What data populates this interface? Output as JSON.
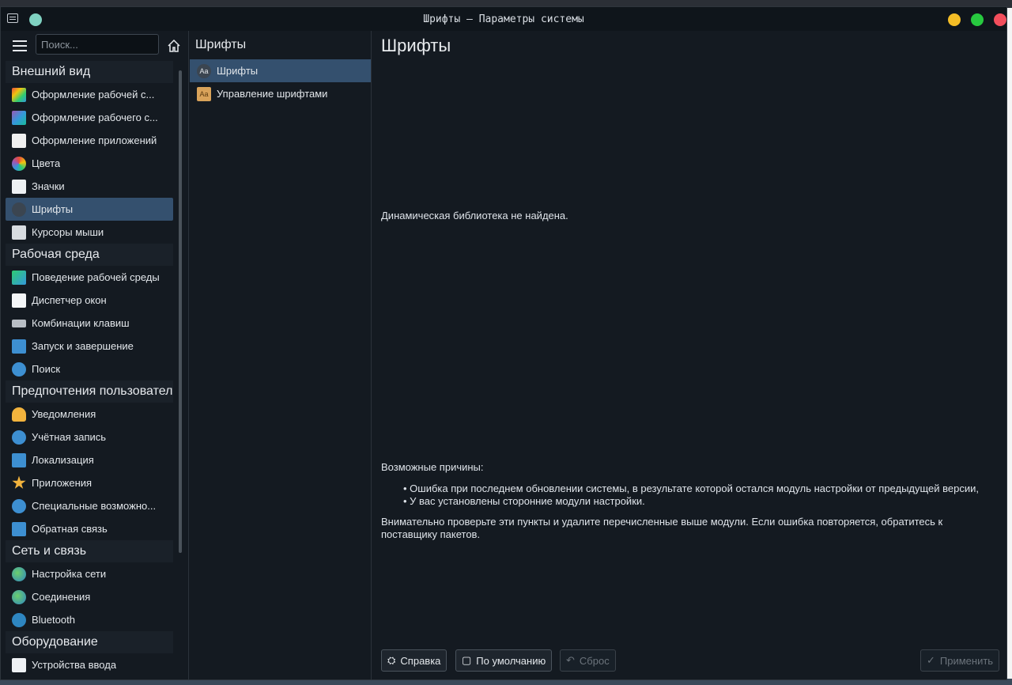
{
  "window": {
    "title": "Шрифты — Параметры системы"
  },
  "sidebar": {
    "search_placeholder": "Поиск...",
    "categories": [
      {
        "label": "Внешний вид",
        "items": [
          {
            "label": "Оформление рабочей с...",
            "icon": "appearance-icon"
          },
          {
            "label": "Оформление рабочего с...",
            "icon": "desktop-theme-icon"
          },
          {
            "label": "Оформление приложений",
            "icon": "app-style-icon"
          },
          {
            "label": "Цвета",
            "icon": "colors-icon"
          },
          {
            "label": "Значки",
            "icon": "icons-icon"
          },
          {
            "label": "Шрифты",
            "icon": "fonts-icon",
            "selected": true
          },
          {
            "label": "Курсоры мыши",
            "icon": "cursor-icon"
          }
        ]
      },
      {
        "label": "Рабочая среда",
        "items": [
          {
            "label": "Поведение рабочей среды",
            "icon": "workspace-icon"
          },
          {
            "label": "Диспетчер окон",
            "icon": "window-manager-icon"
          },
          {
            "label": "Комбинации клавиш",
            "icon": "keyboard-icon"
          },
          {
            "label": "Запуск и завершение",
            "icon": "startup-icon"
          },
          {
            "label": "Поиск",
            "icon": "search-icon"
          }
        ]
      },
      {
        "label": "Предпочтения пользовател",
        "items": [
          {
            "label": "Уведомления",
            "icon": "bell-icon"
          },
          {
            "label": "Учётная запись",
            "icon": "user-icon"
          },
          {
            "label": "Локализация",
            "icon": "locale-icon"
          },
          {
            "label": "Приложения",
            "icon": "star-icon"
          },
          {
            "label": "Специальные возможно...",
            "icon": "accessibility-icon"
          },
          {
            "label": "Обратная связь",
            "icon": "feedback-icon"
          }
        ]
      },
      {
        "label": "Сеть и связь",
        "items": [
          {
            "label": "Настройка сети",
            "icon": "globe-icon"
          },
          {
            "label": "Соединения",
            "icon": "globe-icon"
          },
          {
            "label": "Bluetooth",
            "icon": "bluetooth-icon"
          }
        ]
      },
      {
        "label": "Оборудование",
        "items": [
          {
            "label": "Устройства ввода",
            "icon": "input-devices-icon"
          }
        ]
      }
    ]
  },
  "mid": {
    "title": "Шрифты",
    "items": [
      {
        "label": "Шрифты",
        "selected": true
      },
      {
        "label": "Управление шрифтами"
      }
    ]
  },
  "main": {
    "title": "Шрифты",
    "error": "Динамическая библиотека не найдена.",
    "reasons_title": "Возможные причины:",
    "reasons": [
      "Ошибка при последнем обновлении системы, в результате которой остался модуль настройки от предыдущей версии,",
      "У вас установлены сторонние модули настройки."
    ],
    "advice": "Внимательно проверьте эти пункты и удалите перечисленные выше модули. Если ошибка повторяется, обратитесь к поставщику пакетов."
  },
  "footer": {
    "help": "Справка",
    "defaults": "По умолчанию",
    "reset": "Сброс",
    "apply": "Применить"
  },
  "colors": {
    "accent": "#34506e",
    "background": "#141a21"
  }
}
